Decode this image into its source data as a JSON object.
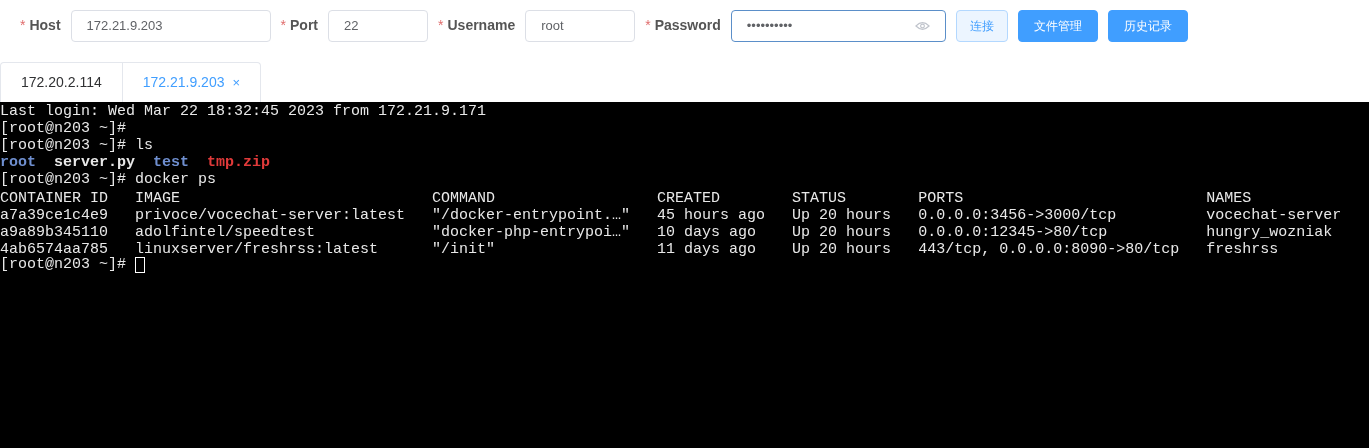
{
  "form": {
    "fields": [
      {
        "label": "Host",
        "required_mark": "*",
        "value": "172.21.9.203",
        "kind": "text",
        "focused": false
      },
      {
        "label": "Port",
        "required_mark": "*",
        "value": "22",
        "kind": "text",
        "focused": false
      },
      {
        "label": "Username",
        "required_mark": "*",
        "value": "root",
        "kind": "text",
        "focused": false
      },
      {
        "label": "Password",
        "required_mark": "*",
        "value": "••••••••••",
        "kind": "password",
        "focused": true
      }
    ],
    "buttons": [
      {
        "label": "连接",
        "kind": "plain"
      },
      {
        "label": "文件管理",
        "kind": "primary"
      },
      {
        "label": "历史记录",
        "kind": "primary"
      }
    ]
  },
  "tabs": [
    {
      "label": "172.20.2.114",
      "selected": false
    },
    {
      "label": "172.21.9.203",
      "selected": true,
      "close": "×"
    }
  ],
  "terminal": {
    "lines": [
      {
        "kind": "text",
        "text": "Last login: Wed Mar 22 18:32:45 2023 from 172.21.9.171"
      },
      {
        "kind": "prompt",
        "prompt": "[root@n203 ~]#"
      },
      {
        "kind": "prompt",
        "prompt": "[root@n203 ~]#",
        "command": "ls"
      },
      {
        "kind": "listing",
        "items": [
          {
            "name": "root",
            "color": "#6f8fd0"
          },
          {
            "name": "server.py",
            "color": "#e8e8e8"
          },
          {
            "name": "test",
            "color": "#6f8fd0"
          },
          {
            "name": "tmp.zip",
            "color": "#e03a3a"
          }
        ]
      },
      {
        "kind": "prompt",
        "prompt": "[root@n203 ~]#",
        "command": "docker ps"
      },
      {
        "kind": "table",
        "columns": [
          "CONTAINER ID",
          "IMAGE",
          "COMMAND",
          "CREATED",
          "STATUS",
          "PORTS",
          "NAMES"
        ],
        "rows": [
          [
            "a7a39ce1c4e9",
            "privoce/vocechat-server:latest",
            "\"/docker-entrypoint.…\"",
            "45 hours ago",
            "Up 20 hours",
            "0.0.0.0:3456->3000/tcp",
            "vocechat-server"
          ],
          [
            "a9a89b345110",
            "adolfintel/speedtest",
            "\"docker-php-entrypoi…\"",
            "10 days ago",
            "Up 20 hours",
            "0.0.0.0:12345->80/tcp",
            "hungry_wozniak"
          ],
          [
            "4ab6574aa785",
            "linuxserver/freshrss:latest",
            "\"/init\"",
            "11 days ago",
            "Up 20 hours",
            "443/tcp, 0.0.0.0:8090->80/tcp",
            "freshrss"
          ]
        ]
      },
      {
        "kind": "prompt",
        "prompt": "[root@n203 ~]#",
        "cursor": true
      }
    ]
  }
}
